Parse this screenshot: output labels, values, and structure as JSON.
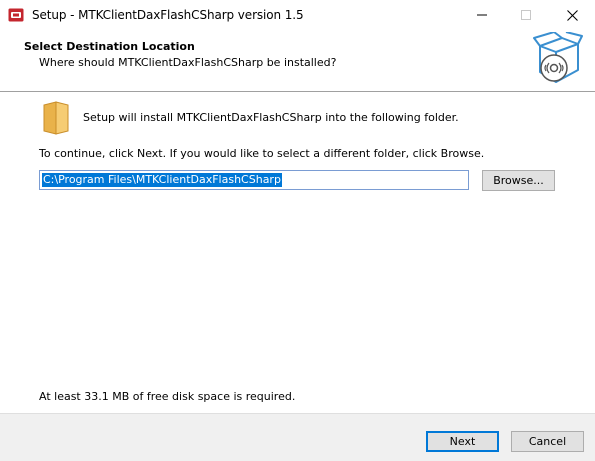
{
  "window": {
    "title": "Setup - MTKClientDaxFlashCSharp version 1.5"
  },
  "titlebar": {
    "minimize_icon": "minimize-icon",
    "maximize_icon": "maximize-icon",
    "close_icon": "close-icon"
  },
  "header": {
    "title": "Select Destination Location",
    "subtitle": "Where should MTKClientDaxFlashCSharp be installed?",
    "image_icon": "box-disc-icon"
  },
  "main": {
    "folder_icon": "folder-icon",
    "install_text": "Setup will install MTKClientDaxFlashCSharp into the following folder.",
    "continue_text": "To continue, click Next. If you would like to select a different folder, click Browse.",
    "path_value": "C:\\Program Files\\MTKClientDaxFlashCSharp",
    "browse_label": "Browse...",
    "disk_space_text": "At least 33.1 MB of free disk space is required."
  },
  "footer": {
    "next_label": "Next",
    "cancel_label": "Cancel"
  },
  "colors": {
    "accent": "#0078d7",
    "button_face": "#e1e1e1",
    "footer_bg": "#f0f0f0",
    "app_icon_red": "#c4262e"
  }
}
